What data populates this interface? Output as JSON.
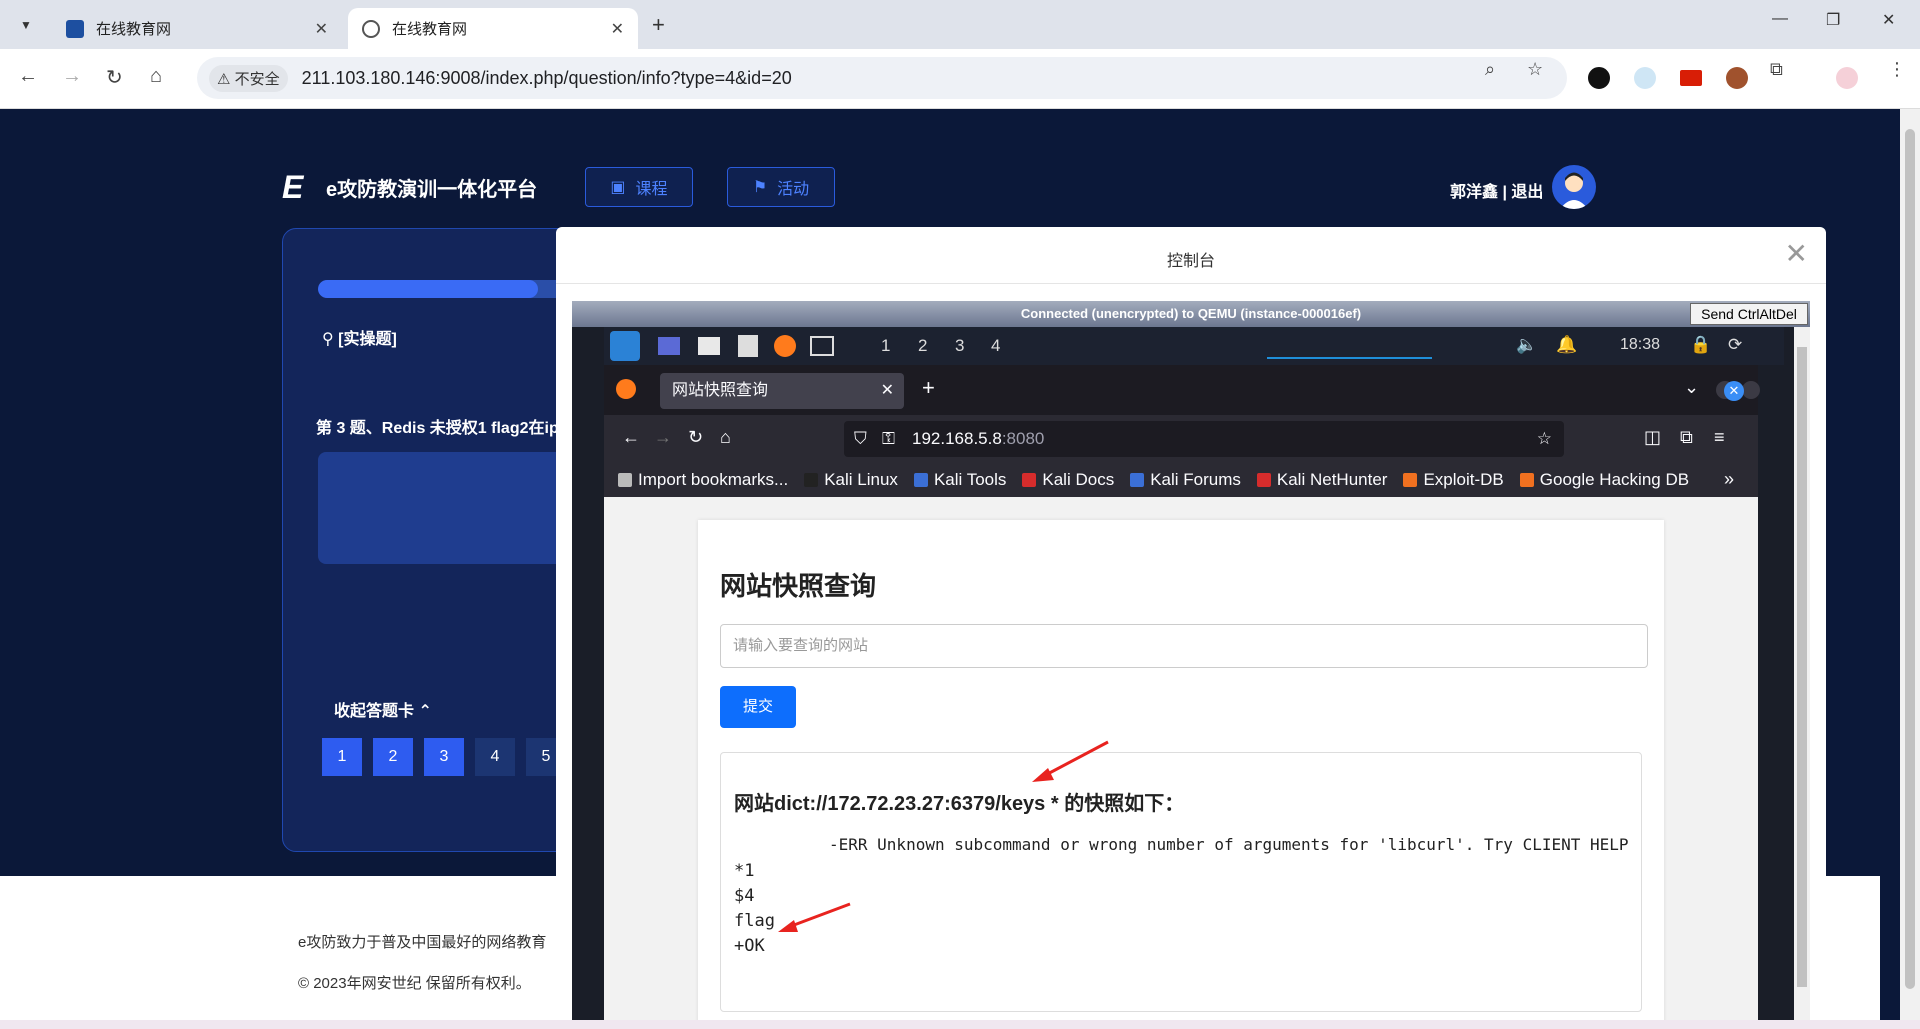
{
  "browser": {
    "tabs": [
      {
        "title": "在线教育网",
        "active": false
      },
      {
        "title": "在线教育网",
        "active": true
      }
    ],
    "security_label": "不安全",
    "url": "211.103.180.146:9008/index.php/question/info?type=4&id=20"
  },
  "site": {
    "logo_text": "e攻防教演训一体化平台",
    "nav": [
      {
        "label": "课程",
        "icon": "book-icon"
      },
      {
        "label": "活动",
        "icon": "flag-icon"
      }
    ],
    "user_name": "郭洋鑫",
    "separator": "|",
    "logout_label": "退出",
    "progress": 0.44,
    "question_type": "[实操题]",
    "question_title": "第 3 题、Redis 未授权1 flag2在ip",
    "collapse_label": "收起答题卡",
    "question_numbers": [
      {
        "n": "1",
        "done": true
      },
      {
        "n": "2",
        "done": true
      },
      {
        "n": "3",
        "done": true
      },
      {
        "n": "4",
        "done": false
      },
      {
        "n": "5",
        "done": false
      }
    ],
    "footer_line1": "e攻防致力于普及中国最好的网络教育",
    "footer_line2": "© 2023年网安世纪 保留所有权利。"
  },
  "modal": {
    "title": "控制台",
    "vnc_status": "Connected (unencrypted) to QEMU (instance-000016ef)",
    "vnc_button": "Send CtrlAltDel"
  },
  "kali": {
    "workspaces": [
      "1",
      "2",
      "3",
      "4"
    ],
    "clock": "18:38"
  },
  "firefox": {
    "tab_title": "网站快照查询",
    "url_host": "192.168.5.8",
    "url_port": ":8080",
    "bookmarks": [
      {
        "label": "Import bookmarks...",
        "color": "#bbbbbb"
      },
      {
        "label": "Kali Linux",
        "color": "#222222"
      },
      {
        "label": "Kali Tools",
        "color": "#3b6fd6"
      },
      {
        "label": "Kali Docs",
        "color": "#d62c2c"
      },
      {
        "label": "Kali Forums",
        "color": "#3b6fd6"
      },
      {
        "label": "Kali NetHunter",
        "color": "#d62c2c"
      },
      {
        "label": "Exploit-DB",
        "color": "#f07020"
      },
      {
        "label": "Google Hacking DB",
        "color": "#f07020"
      }
    ]
  },
  "page": {
    "heading": "网站快照查询",
    "input_placeholder": "请输入要查询的网站",
    "submit_label": "提交",
    "result_heading": "网站dict://172.72.23.27:6379/keys * 的快照如下：",
    "error_line": "-ERR Unknown subcommand or wrong number of arguments for 'libcurl'. Try CLIENT HELP",
    "lines": [
      "*1",
      "$4",
      "flag",
      "+OK"
    ]
  },
  "colors": {
    "site_bg": "#0b1839",
    "accent": "#2e5cf0",
    "submit": "#0d6efd",
    "arrow": "#e8231f"
  }
}
